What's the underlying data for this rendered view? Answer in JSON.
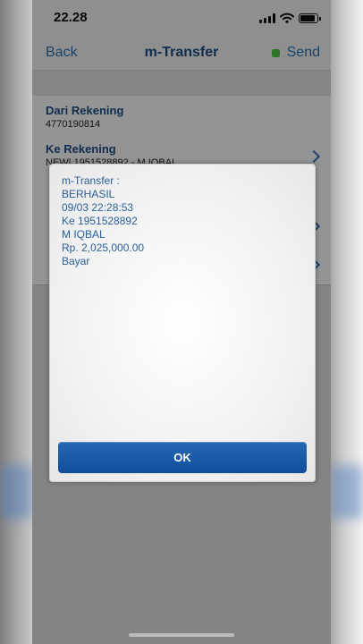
{
  "status_bar": {
    "time": "22.28"
  },
  "nav": {
    "back": "Back",
    "title": "m-Transfer",
    "send": "Send"
  },
  "form": {
    "dari_label": "Dari Rekening",
    "dari_value": "4770190814",
    "ke_label": "Ke Rekening",
    "ke_value": "NEW| 1951528892 - M IQBAL"
  },
  "dialog": {
    "lines": [
      "m-Transfer :",
      "BERHASIL",
      "09/03 22:28:53",
      "Ke 1951528892",
      "M IQBAL",
      "Rp. 2,025,000.00",
      "Bayar"
    ],
    "ok": "OK"
  },
  "colors": {
    "accent": "#2e73b8",
    "title": "#1d4f86",
    "send_indicator": "#57c84d",
    "button": "#1a5ca8"
  },
  "icons": [
    "signal-icon",
    "wifi-icon",
    "battery-icon",
    "chevron-right-icon",
    "send-status-icon"
  ]
}
